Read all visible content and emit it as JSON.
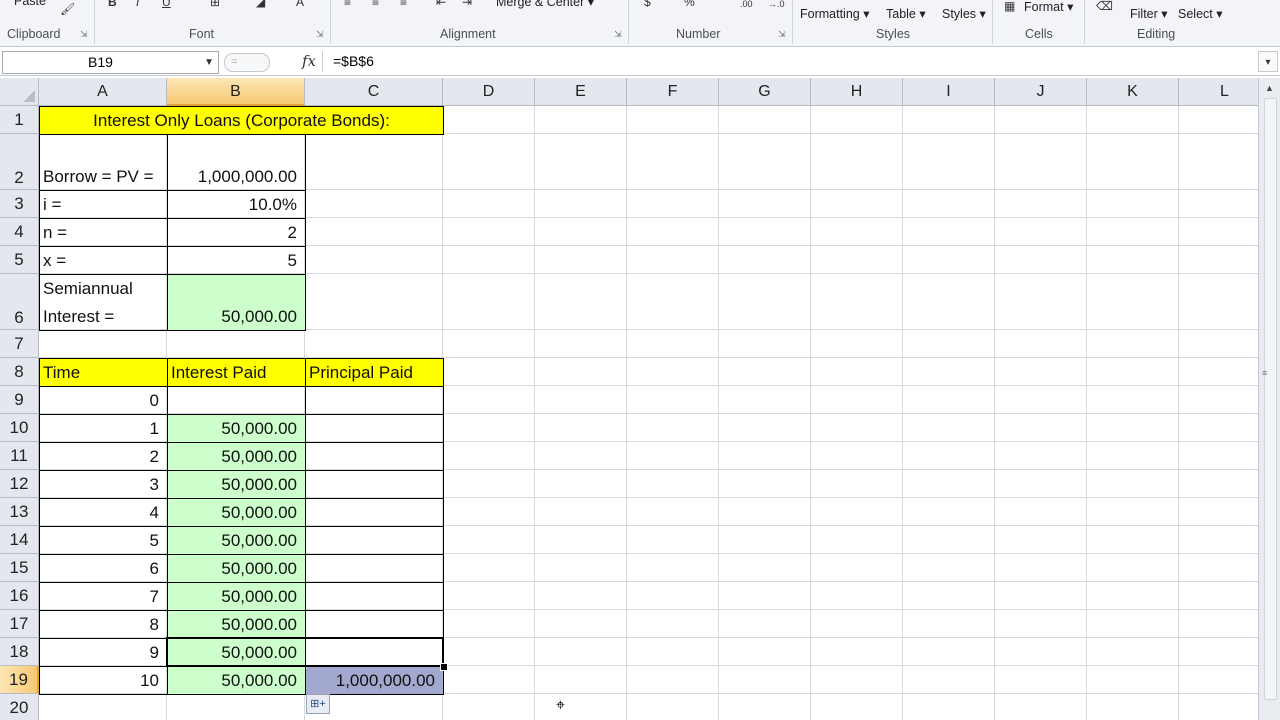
{
  "ribbon": {
    "groups": [
      "Clipboard",
      "Font",
      "Alignment",
      "Number",
      "Styles",
      "Cells",
      "Editing"
    ],
    "buttons": {
      "paste_partial": "Paste",
      "merge_center": "Merge & Center",
      "conditional_formatting": "Formatting",
      "format_as_table": "Table",
      "cell_styles": "Styles",
      "format": "Format",
      "sort_filter": "Filter",
      "find_select": "Select"
    },
    "icons": [
      "format-painter-icon",
      "bold-icon",
      "italic-icon",
      "underline-icon",
      "fill-color-icon",
      "font-color-icon",
      "align-left-icon",
      "align-center-icon",
      "align-right-icon",
      "indent-icon",
      "outdent-icon",
      "currency-icon",
      "percent-icon",
      "increase-decimal-icon",
      "decrease-decimal-icon",
      "eraser-icon"
    ]
  },
  "formula_bar": {
    "name_box": "B19",
    "fx_label": "fx",
    "formula": "=$B$6"
  },
  "columns": [
    "A",
    "B",
    "C",
    "D",
    "E",
    "F",
    "G",
    "H",
    "I",
    "J",
    "K",
    "L"
  ],
  "rows": [
    "1",
    "2",
    "3",
    "4",
    "5",
    "6",
    "7",
    "8",
    "9",
    "10",
    "11",
    "12",
    "13",
    "14",
    "15",
    "16",
    "17",
    "18",
    "19",
    "20"
  ],
  "selected_column": "B",
  "selected_row": "19",
  "cells": {
    "A1": "Interest Only Loans (Corporate Bonds):",
    "A2": "Borrow = PV =",
    "B2": "1,000,000.00",
    "A3": "i =",
    "B3": "10.0%",
    "A4": "n =",
    "B4": "2",
    "A5": "x =",
    "B5": "5",
    "A6_line1": "Semiannual",
    "A6_line2": "Interest =",
    "B6": "50,000.00",
    "A8": "Time",
    "B8": "Interest Paid",
    "C8": "Principal Paid",
    "table": [
      {
        "time": "0",
        "interest": "",
        "principal": ""
      },
      {
        "time": "1",
        "interest": "50,000.00",
        "principal": ""
      },
      {
        "time": "2",
        "interest": "50,000.00",
        "principal": ""
      },
      {
        "time": "3",
        "interest": "50,000.00",
        "principal": ""
      },
      {
        "time": "4",
        "interest": "50,000.00",
        "principal": ""
      },
      {
        "time": "5",
        "interest": "50,000.00",
        "principal": ""
      },
      {
        "time": "6",
        "interest": "50,000.00",
        "principal": ""
      },
      {
        "time": "7",
        "interest": "50,000.00",
        "principal": ""
      },
      {
        "time": "8",
        "interest": "50,000.00",
        "principal": ""
      },
      {
        "time": "9",
        "interest": "50,000.00",
        "principal": ""
      },
      {
        "time": "10",
        "interest": "50,000.00",
        "principal": "1,000,000.00"
      }
    ]
  },
  "colors": {
    "title_fill": "#ffff00",
    "input_fill": "#ccffcc",
    "selection_fill": "#a3a8cf"
  }
}
